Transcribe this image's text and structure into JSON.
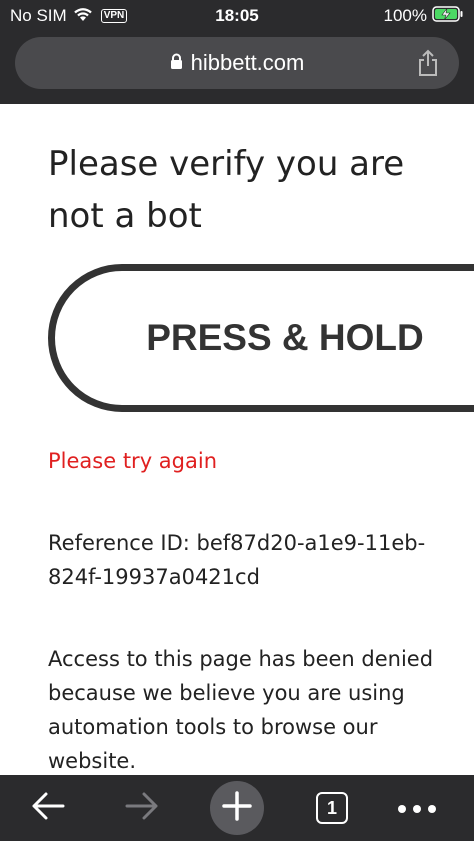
{
  "status_bar": {
    "carrier": "No SIM",
    "vpn": "VPN",
    "time": "18:05",
    "battery": "100%",
    "battery_level": 1.0,
    "battery_color": "#4cd964"
  },
  "browser": {
    "url": "hibbett.com",
    "tab_count": "1"
  },
  "page": {
    "title": "Please verify you are not a bot",
    "button_label": "PRESS & HOLD",
    "error": "Please try again",
    "reference": "Reference ID: bef87d20-a1e9-11eb-824f-19937a0421cd",
    "message": "Access to this page has been denied because we believe you are using automation tools to browse our website."
  },
  "colors": {
    "error_red": "#e02020",
    "chrome_dark": "#2b2b2d",
    "button_border": "#333333"
  },
  "icons": [
    "wifi-icon",
    "lock-icon",
    "share-icon",
    "charging-battery-icon",
    "back-arrow-icon",
    "forward-arrow-icon",
    "plus-icon",
    "more-dots-icon"
  ]
}
